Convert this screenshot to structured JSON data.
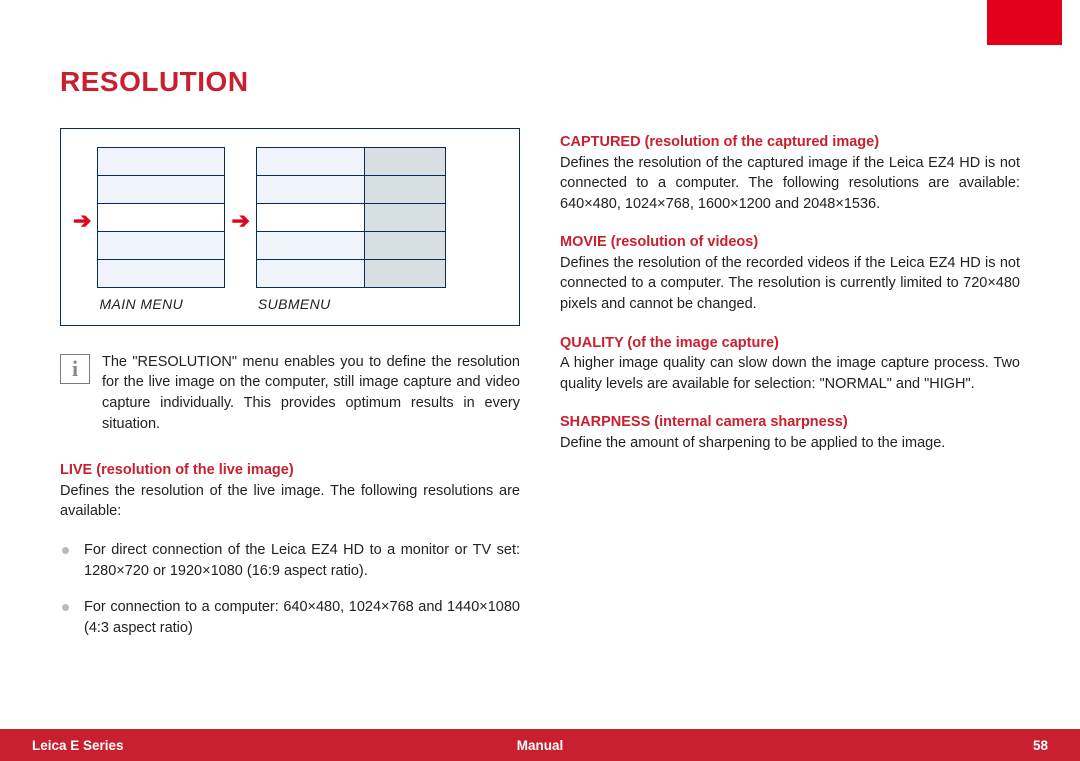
{
  "title": "RESOLUTION",
  "diagram": {
    "main_label": "MAIN MENU",
    "sub_label": "SUBMENU"
  },
  "intro": "The \"RESOLUTION\" menu enables you to define the resolution for the live image on the computer, still image capture and video capture individually. This provides optimum results in every situation.",
  "left": {
    "live_head": "LIVE (resolution of the live image)",
    "live_body": "Defines the resolution of the live image. The following resolutions are available:",
    "bullet1": "For direct connection of the Leica EZ4 HD to a monitor or TV set: 1280×720 or 1920×1080 (16:9 aspect ratio).",
    "bullet2": "For connection to a computer: 640×480, 1024×768 and 1440×1080 (4:3 aspect ratio)"
  },
  "right": {
    "captured_head": "CAPTURED (resolution of the captured image)",
    "captured_body": "Defines the resolution of the captured image if the Leica EZ4 HD is not connected to a computer. The following resolutions are available: 640×480, 1024×768, 1600×1200 and 2048×1536.",
    "movie_head": "MOVIE (resolution of videos)",
    "movie_body": "Defines the resolution of the recorded videos if the Leica EZ4 HD is not connected to a computer. The resolution is currently limited to 720×480 pixels and cannot be changed.",
    "quality_head": "QUALITY (of the image capture)",
    "quality_body": "A higher image quality can slow down the image capture process. Two quality levels are available for selection: \"NORMAL\" and \"HIGH\".",
    "sharp_head": "SHARPNESS (internal camera sharpness)",
    "sharp_body": "Define the amount of sharpening to be applied to the image."
  },
  "footer": {
    "left": "Leica E Series",
    "center": "Manual",
    "right": "58"
  }
}
